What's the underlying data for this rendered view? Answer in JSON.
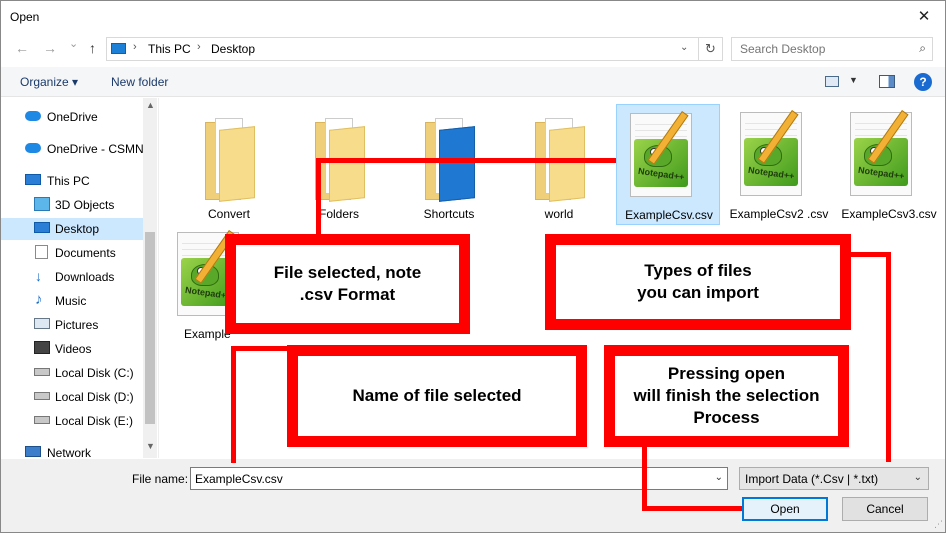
{
  "window": {
    "title": "Open",
    "close_glyph": "✕"
  },
  "nav": {
    "back": "←",
    "forward": "→",
    "recent": "⌄",
    "up": "↑"
  },
  "address": {
    "crumbs": [
      "This PC",
      "Desktop"
    ],
    "separator": "›",
    "dropdown": "⌄",
    "refresh": "↻"
  },
  "search": {
    "placeholder": "Search Desktop",
    "icon": "⌕"
  },
  "commandbar": {
    "organize": "Organize ▾",
    "new_folder": "New folder",
    "help": "?"
  },
  "sidebar": {
    "items": [
      {
        "label": "OneDrive",
        "icon": "cloud-icon"
      },
      {
        "label": "OneDrive - CSMN",
        "icon": "cloud-icon"
      },
      {
        "label": "This PC",
        "icon": "computer-icon"
      },
      {
        "label": "3D Objects",
        "icon": "cube-icon"
      },
      {
        "label": "Desktop",
        "icon": "desktop-icon",
        "selected": true
      },
      {
        "label": "Documents",
        "icon": "documents-icon"
      },
      {
        "label": "Downloads",
        "icon": "download-icon"
      },
      {
        "label": "Music",
        "icon": "music-icon"
      },
      {
        "label": "Pictures",
        "icon": "pictures-icon"
      },
      {
        "label": "Videos",
        "icon": "videos-icon"
      },
      {
        "label": "Local Disk (C:)",
        "icon": "drive-icon"
      },
      {
        "label": "Local Disk (D:)",
        "icon": "drive-icon"
      },
      {
        "label": "Local Disk (E:)",
        "icon": "drive-icon"
      },
      {
        "label": "Network",
        "icon": "network-icon"
      }
    ]
  },
  "files": [
    {
      "name": "Convert",
      "kind": "folder"
    },
    {
      "name": "Folders",
      "kind": "folder"
    },
    {
      "name": "Shortcuts",
      "kind": "folder-blue"
    },
    {
      "name": "world",
      "kind": "folder"
    },
    {
      "name": "ExampleCsv.csv",
      "kind": "csv",
      "selected": true
    },
    {
      "name": "ExampleCsv2 .csv",
      "kind": "csv"
    },
    {
      "name": "ExampleCsv3.csv",
      "kind": "csv"
    },
    {
      "name": "Example",
      "kind": "csv"
    }
  ],
  "npp_logo_word": "Notepad++",
  "annotations": {
    "file_selected": "File selected, note\n.csv Format",
    "types": "Types of files\nyou can import",
    "name": "Name of file selected",
    "open": "Pressing open\nwill finish the selection\nProcess"
  },
  "bottom": {
    "file_name_label": "File name:",
    "file_name_value": "ExampleCsv.csv",
    "file_type_value": "Import Data (*.Csv | *.txt)",
    "open_label": "Open",
    "cancel_label": "Cancel",
    "dropdown": "⌄"
  },
  "colors": {
    "annotation": "#ff0000",
    "selection": "#cce8ff",
    "accent": "#0078d7"
  }
}
